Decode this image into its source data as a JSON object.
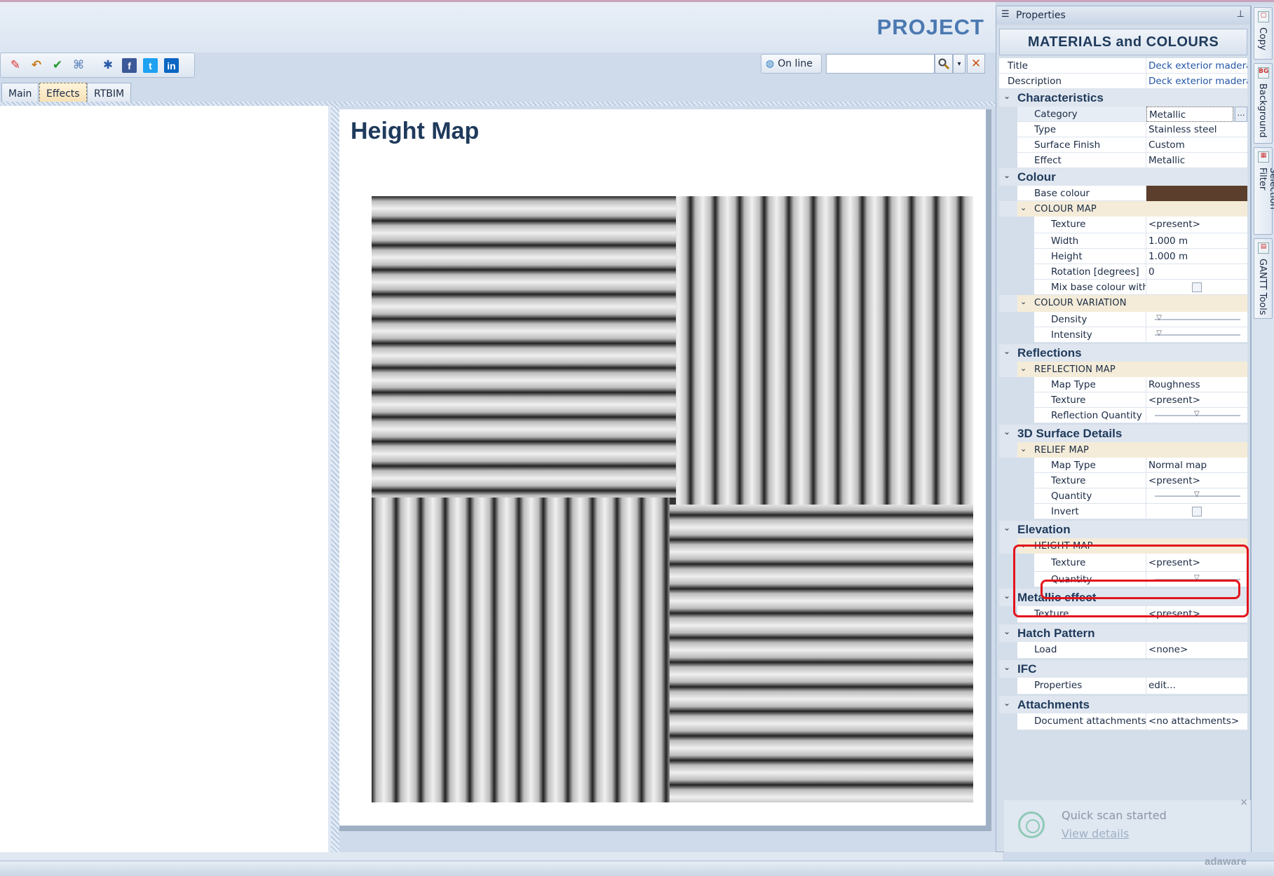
{
  "app": {
    "project_label": "PROJECT"
  },
  "toolbar": {
    "online_label": "On line",
    "search_value": "",
    "tabs": [
      {
        "label": "Main"
      },
      {
        "label": "Effects"
      },
      {
        "label": "RTBIM"
      }
    ]
  },
  "document": {
    "title": "Height Map"
  },
  "properties": {
    "panel_title": "Properties",
    "header": "MATERIALS and COLOURS",
    "title": {
      "label": "Title",
      "value": "Deck exterior madera en"
    },
    "description": {
      "label": "Description",
      "value": "Deck exterior madera en"
    },
    "characteristics": {
      "label": "Characteristics",
      "category": {
        "label": "Category",
        "value": "Metallic"
      },
      "type": {
        "label": "Type",
        "value": "Stainless steel"
      },
      "surface_finish": {
        "label": "Surface Finish",
        "value": "Custom"
      },
      "effect": {
        "label": "Effect",
        "value": "Metallic"
      }
    },
    "colour": {
      "label": "Colour",
      "base_colour": {
        "label": "Base colour",
        "value": "#5b3f2c"
      },
      "colour_map": {
        "label": "COLOUR MAP",
        "texture": {
          "label": "Texture",
          "value": "<present>"
        },
        "width": {
          "label": "Width",
          "value": "1.000 m"
        },
        "height": {
          "label": "Height",
          "value": "1.000 m"
        },
        "rotation": {
          "label": "Rotation  [degrees]",
          "value": "0"
        },
        "mix": {
          "label": "Mix base colour with",
          "checked": false
        }
      },
      "colour_variation": {
        "label": "COLOUR VARIATION",
        "density": {
          "label": "Density",
          "level": 0.02
        },
        "intensity": {
          "label": "Intensity",
          "level": 0.02
        }
      }
    },
    "reflections": {
      "label": "Reflections",
      "reflection_map": {
        "label": "REFLECTION MAP",
        "map_type": {
          "label": "Map Type",
          "value": "Roughness"
        },
        "texture": {
          "label": "Texture",
          "value": "<present>"
        },
        "quantity": {
          "label": "Reflection Quantity",
          "level": 0.5
        }
      }
    },
    "surface_details": {
      "label": "3D Surface Details",
      "relief_map": {
        "label": "RELIEF MAP",
        "map_type": {
          "label": "Map Type",
          "value": "Normal map"
        },
        "texture": {
          "label": "Texture",
          "value": "<present>"
        },
        "quantity": {
          "label": "Quantity",
          "level": 0.5
        },
        "invert": {
          "label": "Invert",
          "checked": false
        }
      }
    },
    "elevation": {
      "label": "Elevation",
      "height_map": {
        "label": "HEIGHT MAP",
        "texture": {
          "label": "Texture",
          "value": "<present>"
        },
        "quantity": {
          "label": "Quantity",
          "level": 0.5
        }
      }
    },
    "metallic_effect": {
      "label": "Metallic effect",
      "texture": {
        "label": "Texture",
        "value": "<present>"
      }
    },
    "hatch_pattern": {
      "label": "Hatch Pattern",
      "load": {
        "label": "Load",
        "value": "<none>"
      }
    },
    "ifc": {
      "label": "IFC",
      "properties": {
        "label": "Properties",
        "value": "edit..."
      }
    },
    "attachments": {
      "label": "Attachments",
      "documents": {
        "label": "Document attachments",
        "value": "<no attachments>"
      }
    }
  },
  "sidebar": {
    "tabs": [
      {
        "label": "Copy"
      },
      {
        "label": "Background"
      },
      {
        "label": "Selection Filter"
      },
      {
        "label": "GANTT Tools"
      }
    ]
  },
  "toast": {
    "title": "Quick scan started",
    "link": "View details",
    "close": "×",
    "brand": "adaware"
  },
  "colors": {
    "accent": "#4b79b1",
    "highlight": "#e3141c",
    "base_colour": "#5b3f2c"
  }
}
